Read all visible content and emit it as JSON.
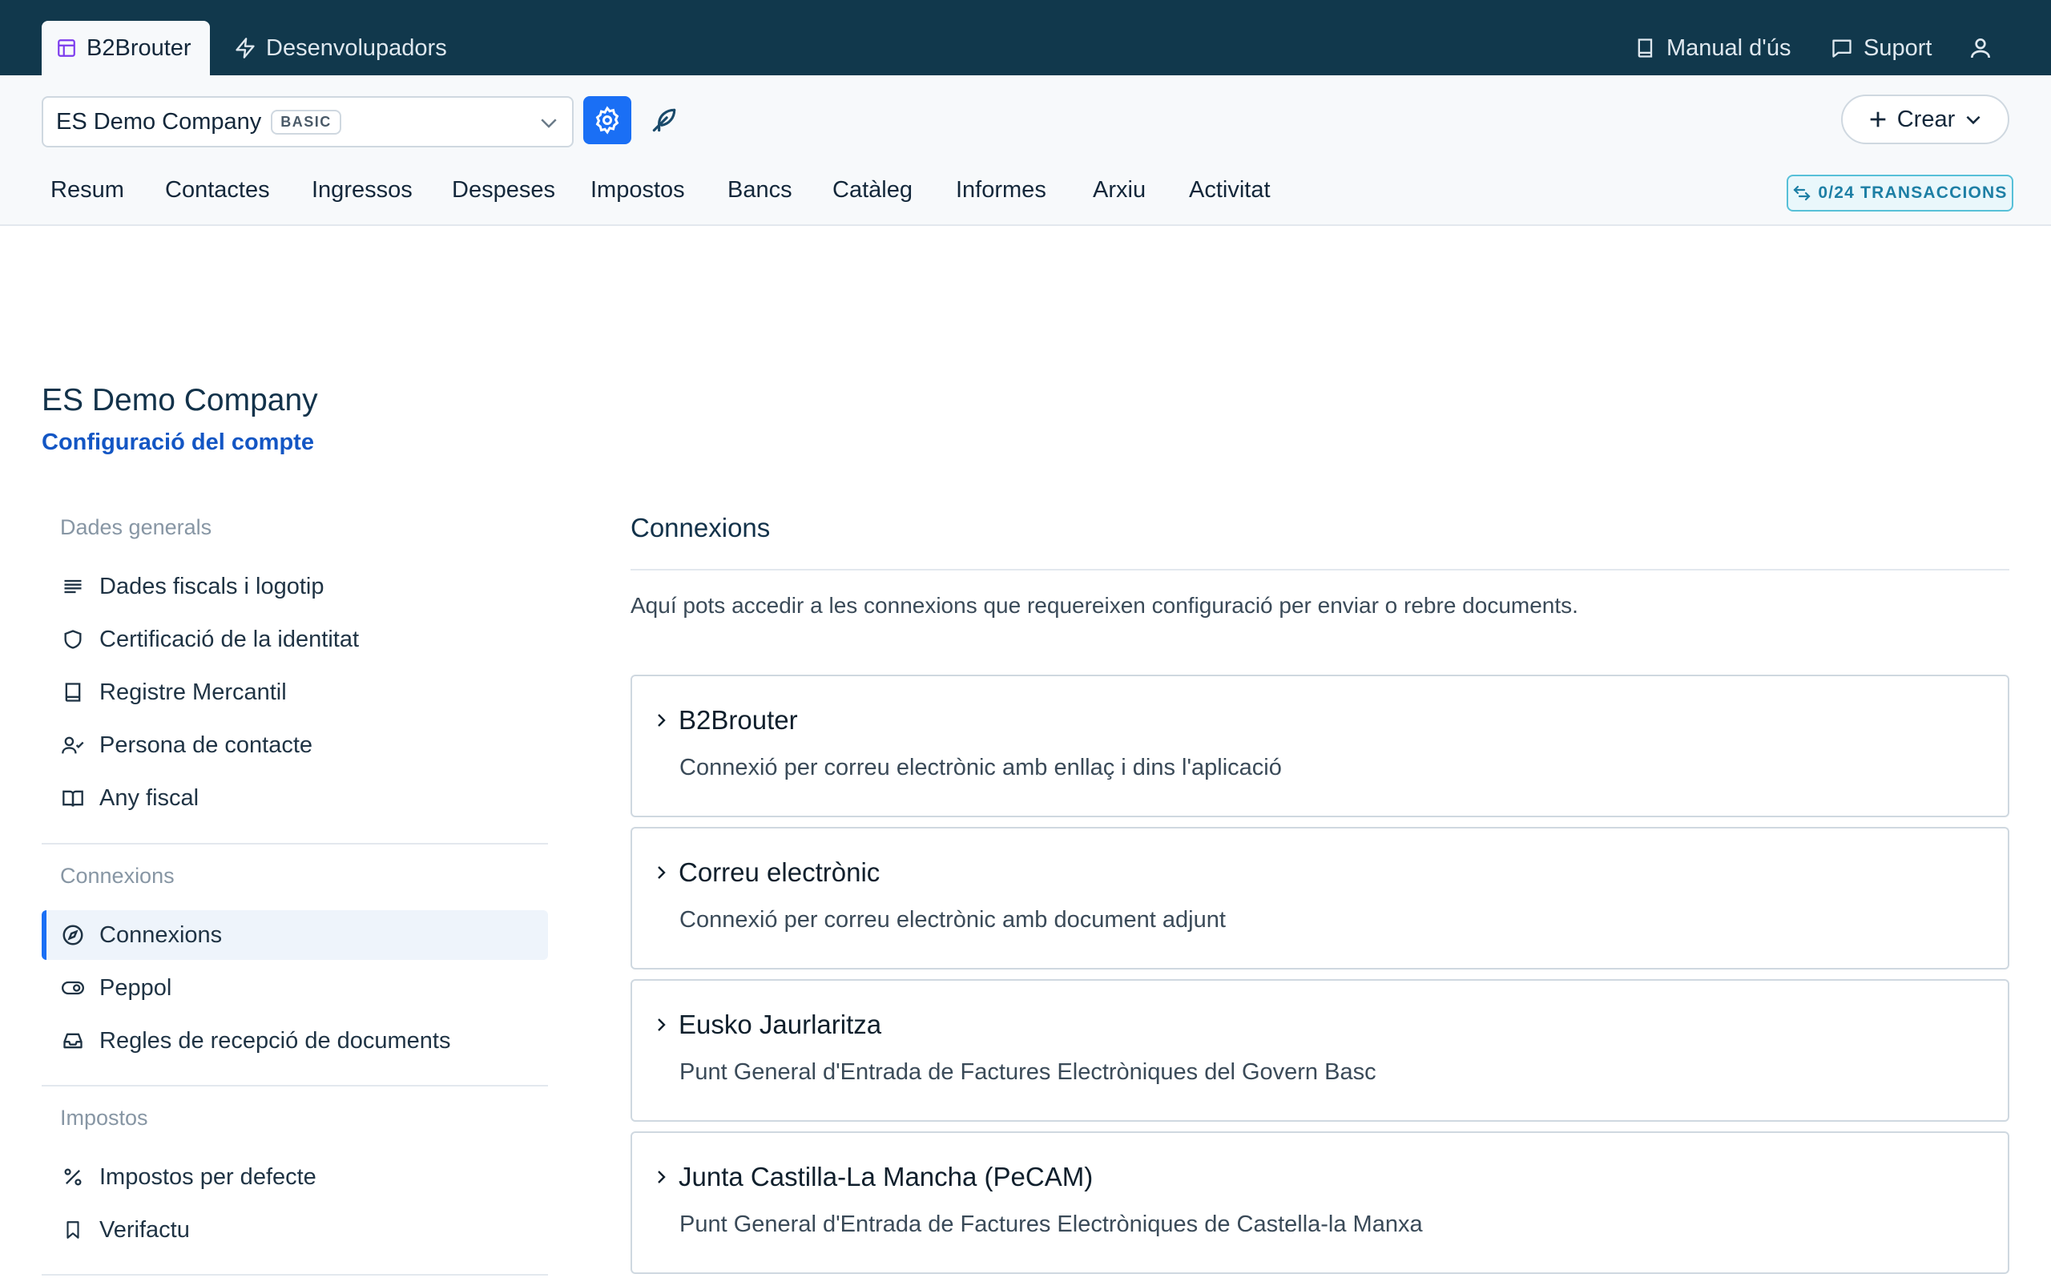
{
  "topbar": {
    "app_tab": "B2Brouter",
    "dev_tab": "Desenvolupadors",
    "manual": "Manual d'ús",
    "support": "Suport"
  },
  "company": {
    "name": "ES Demo Company",
    "plan": "BASIC"
  },
  "actions": {
    "create": "Crear"
  },
  "nav": [
    "Resum",
    "Contactes",
    "Ingressos",
    "Despeses",
    "Impostos",
    "Bancs",
    "Catàleg",
    "Informes",
    "Arxiu",
    "Activitat"
  ],
  "transactions_badge": "0/24 TRANSACCIONS",
  "page": {
    "title": "ES Demo Company",
    "subtitle": "Configuració del compte"
  },
  "sidebar": {
    "groups": [
      {
        "title": "Dades generals",
        "items": [
          {
            "label": "Dades fiscals i logotip",
            "icon": "text-lines-icon"
          },
          {
            "label": "Certificació de la identitat",
            "icon": "shield-icon"
          },
          {
            "label": "Registre Mercantil",
            "icon": "book-icon"
          },
          {
            "label": "Persona de contacte",
            "icon": "user-check-icon"
          },
          {
            "label": "Any fiscal",
            "icon": "book-open-icon"
          }
        ]
      },
      {
        "title": "Connexions",
        "items": [
          {
            "label": "Connexions",
            "icon": "compass-icon",
            "active": true
          },
          {
            "label": "Peppol",
            "icon": "toggle-icon"
          },
          {
            "label": "Regles de recepció de documents",
            "icon": "inbox-icon"
          }
        ]
      },
      {
        "title": "Impostos",
        "items": [
          {
            "label": "Impostos per defecte",
            "icon": "percent-icon"
          },
          {
            "label": "Verifactu",
            "icon": "bookmark-icon"
          }
        ]
      }
    ]
  },
  "main": {
    "title": "Connexions",
    "description": "Aquí pots accedir a les connexions que requereixen configuració per enviar o rebre documents.",
    "connections": [
      {
        "title": "B2Brouter",
        "subtitle": "Connexió per correu electrònic amb enllaç i dins l'aplicació"
      },
      {
        "title": "Correu electrònic",
        "subtitle": "Connexió per correu electrònic amb document adjunt"
      },
      {
        "title": "Eusko Jaurlaritza",
        "subtitle": "Punt General d'Entrada de Factures Electròniques del Govern Basc"
      },
      {
        "title": "Junta Castilla-La Mancha (PeCAM)",
        "subtitle": "Punt General d'Entrada de Factures Electròniques de Castella-la Manxa"
      }
    ]
  },
  "colors": {
    "topbar": "#11384c",
    "accent": "#1a6ff5",
    "link": "#1356c4",
    "badge": "#1d7fa5"
  }
}
